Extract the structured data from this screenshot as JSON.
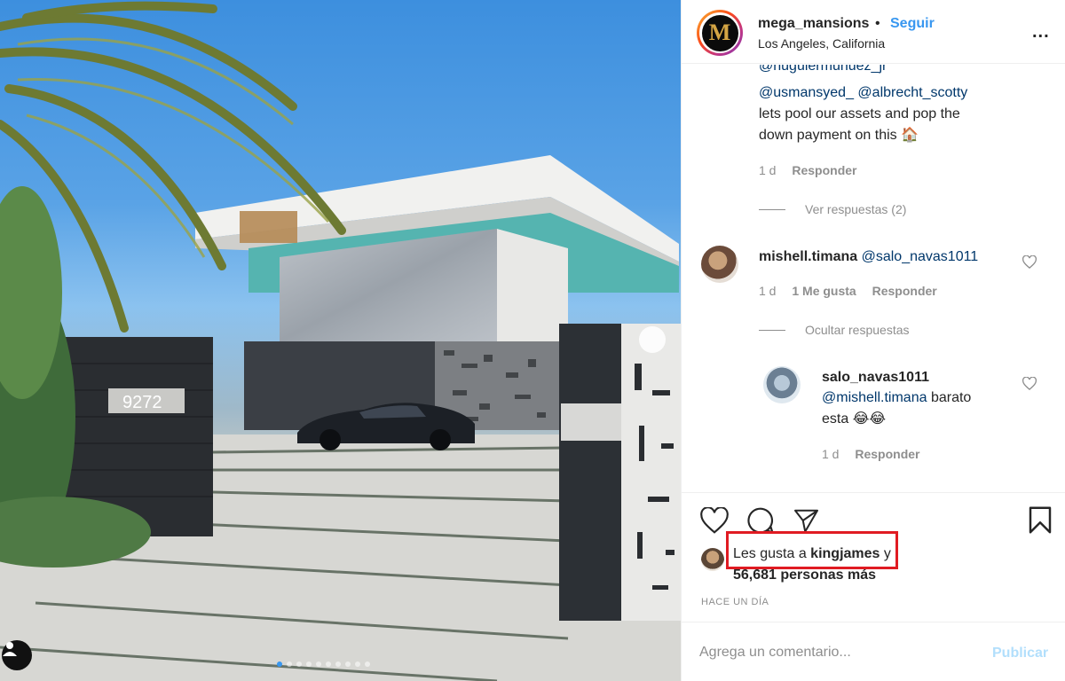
{
  "photo": {
    "house_number": "9272",
    "carousel": {
      "total": 10,
      "active_index": 0
    }
  },
  "header": {
    "avatar_letter": "M",
    "username": "mega_mansions",
    "separator": "•",
    "follow_label": "Seguir",
    "location": "Los Angeles, California",
    "more_label": "..."
  },
  "comments": {
    "top_comment": {
      "cut_mention": "@nuguiermunuez_jr",
      "mention1": "@usmansyed_",
      "mention2": "@albrecht_scotty",
      "text_line1": "lets pool our assets and pop the",
      "text_line2": "down payment on this 🏠",
      "age": "1 d",
      "reply_label": "Responder",
      "view_replies": "Ver respuestas (2)"
    },
    "comment2": {
      "username": "mishell.timana",
      "mention": "@salo_navas1011",
      "age": "1 d",
      "likes": "1 Me gusta",
      "reply_label": "Responder",
      "hide_replies": "Ocultar respuestas"
    },
    "reply1": {
      "username": "salo_navas1011",
      "mention": "@mishell.timana",
      "text_line1": "barato",
      "text_line2": "esta 😂😂",
      "age": "1 d",
      "reply_label": "Responder"
    }
  },
  "likes": {
    "prefix": "Les gusta a ",
    "user": "kingjames",
    "conjunction": " y",
    "count": "56,681",
    "suffix": " personas más"
  },
  "time_ago": "HACE UN DÍA",
  "comment_box": {
    "placeholder": "Agrega un comentario...",
    "publish_label": "Publicar"
  },
  "colors": {
    "accent": "#3897f0",
    "highlight": "#e01b22",
    "publish_disabled": "#b2dffc"
  }
}
